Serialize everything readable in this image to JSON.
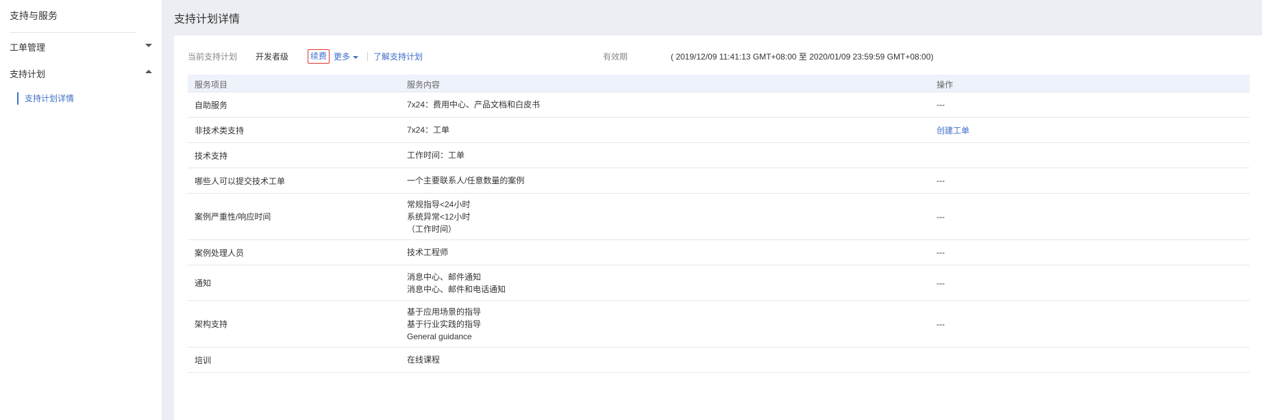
{
  "sidebar": {
    "title": "支持与服务",
    "groups": [
      {
        "label": "工单管理",
        "expanded": false
      },
      {
        "label": "支持计划",
        "expanded": true
      }
    ],
    "active_item": "支持计划详情"
  },
  "header": {
    "title": "支持计划详情"
  },
  "plan": {
    "current_label": "当前支持计划",
    "level": "开发者级",
    "renew": "续费",
    "more": "更多",
    "learn": "了解支持计划",
    "validity_label": "有效期",
    "validity_value": "( 2019/12/09 11:41:13 GMT+08:00 至 2020/01/09 23:59:59 GMT+08:00)"
  },
  "table": {
    "headers": [
      "服务项目",
      "服务内容",
      "操作"
    ],
    "rows": [
      {
        "item": "自助服务",
        "content": [
          "7x24：费用中心、产品文档和白皮书"
        ],
        "action": "---",
        "action_link": false
      },
      {
        "item": "非技术类支持",
        "content": [
          "7x24：工单"
        ],
        "action": "创建工单",
        "action_link": true
      },
      {
        "item": "技术支持",
        "content": [
          "工作时间：工单"
        ],
        "action": "",
        "action_link": false
      },
      {
        "item": "哪些人可以提交技术工单",
        "content": [
          "一个主要联系人/任意数量的案例"
        ],
        "action": "---",
        "action_link": false
      },
      {
        "item": "案例严重性/响应时间",
        "content": [
          "常规指导<24小时",
          "系统异常<12小时",
          "（工作时间）"
        ],
        "action": "---",
        "action_link": false
      },
      {
        "item": "案例处理人员",
        "content": [
          "技术工程师"
        ],
        "action": "---",
        "action_link": false
      },
      {
        "item": "通知",
        "content": [
          "消息中心、邮件通知",
          "消息中心、邮件和电话通知"
        ],
        "action": "---",
        "action_link": false
      },
      {
        "item": "架构支持",
        "content": [
          "基于应用场景的指导",
          "基于行业实践的指导",
          "General guidance"
        ],
        "action": "---",
        "action_link": false
      },
      {
        "item": "培训",
        "content": [
          "在线课程"
        ],
        "action": "",
        "action_link": false
      }
    ]
  }
}
